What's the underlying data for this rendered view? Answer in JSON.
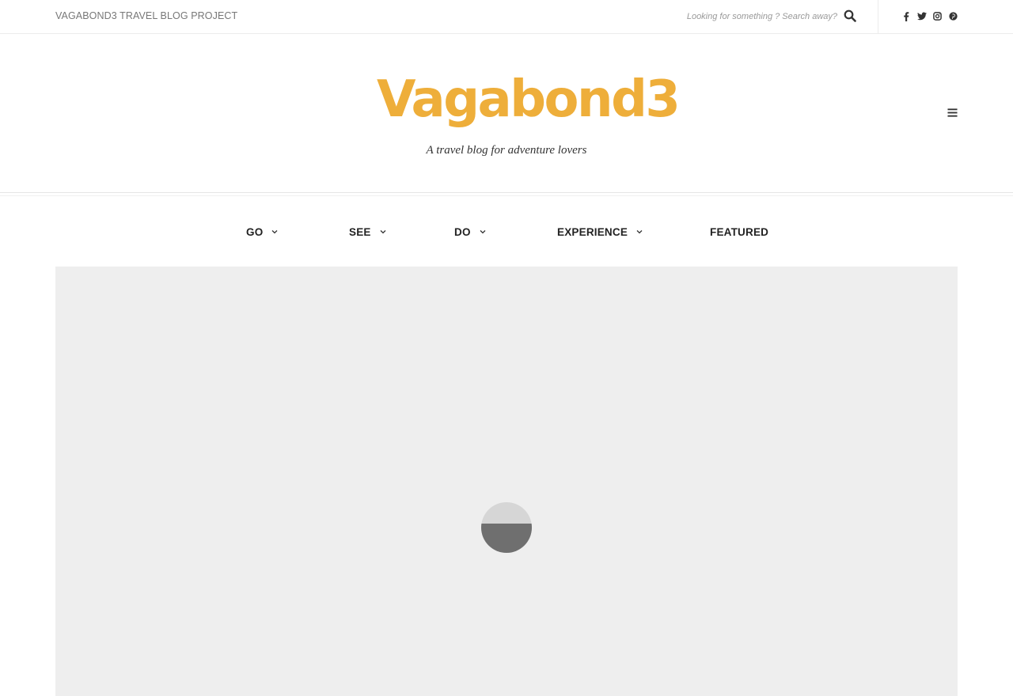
{
  "topbar": {
    "brand": "VAGABOND3 TRAVEL BLOG PROJECT",
    "search_placeholder": "Looking for something ? Search away?",
    "search_icon": "search-icon",
    "social_icons": [
      "facebook-icon",
      "twitter-icon",
      "instagram-icon",
      "pinterest-icon"
    ]
  },
  "header": {
    "logo": "Vagabond3",
    "tagline": "A travel blog for adventure lovers",
    "menu_icon": "hamburger-menu-icon"
  },
  "nav": {
    "items": [
      {
        "label": "GO",
        "has_dropdown": true
      },
      {
        "label": "SEE",
        "has_dropdown": true
      },
      {
        "label": "DO",
        "has_dropdown": true
      },
      {
        "label": "EXPERIENCE",
        "has_dropdown": true
      },
      {
        "label": "FEATURED",
        "has_dropdown": false
      }
    ]
  },
  "colors": {
    "logo": "#eeae3a",
    "hero_background": "#eeeeee",
    "loader_top": "#d6d6d6",
    "loader_bottom": "#6f6f6f"
  }
}
